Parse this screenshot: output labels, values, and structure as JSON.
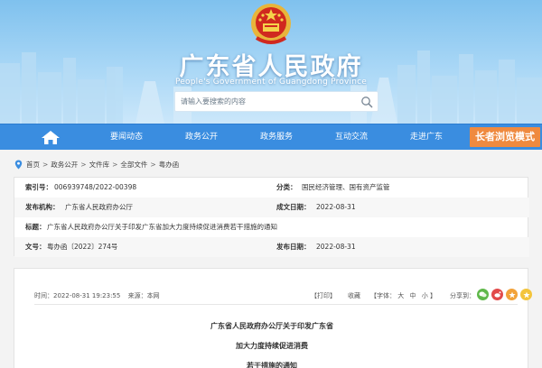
{
  "header": {
    "site_title": "广东省人民政府",
    "site_subtitle": "People's Government of Guangdong Province",
    "search_placeholder": "请输入要搜索的内容",
    "emblem_icon": "national-emblem-icon"
  },
  "nav": {
    "home_icon": "home-icon",
    "items": [
      {
        "label": "要闻动态"
      },
      {
        "label": "政务公开"
      },
      {
        "label": "政务服务"
      },
      {
        "label": "互动交流"
      },
      {
        "label": "走进广东"
      }
    ],
    "elder_mode_label": "长者浏览模式",
    "bg_color": "#3a8de0",
    "elder_color": "#ef8a3f"
  },
  "breadcrumb": {
    "items": [
      "首页",
      "政务公开",
      "文件库",
      "全部文件"
    ],
    "separator": ">",
    "current": "粤办函"
  },
  "info": {
    "index_label": "索引号：",
    "index_value": "006939748/2022-00398",
    "category_label": "分类：",
    "category_value": "国民经济管理、国有资产监管",
    "issuer_label": "发布机构：",
    "issuer_value": "广东省人民政府办公厅",
    "created_label": "成文日期：",
    "created_value": "2022-08-31",
    "title_label": "标题：",
    "title_value": "广东省人民政府办公厅关于印发广东省加大力度持续促进消费若干措施的通知",
    "docno_label": "文号：",
    "docno_value": "粤办函〔2022〕274号",
    "published_label": "发布日期：",
    "published_value": "2022-08-31"
  },
  "article": {
    "time_label": "时间：",
    "time_value": "2022-08-31 19:23:55",
    "source_label": "来源：",
    "source_value": "本网",
    "print_label": "【打印】",
    "favorite_label": "收藏",
    "font_label": "【字体：",
    "font_large": "大",
    "font_medium": "中",
    "font_small": "小",
    "font_close": "】",
    "share_label": "分享到：",
    "share_icons": [
      "wechat-icon",
      "weibo-icon",
      "qzone-icon",
      "favorite-star-icon"
    ],
    "share_colors": [
      "#5fb84a",
      "#e24a4a",
      "#f2a23a",
      "#f3c43b"
    ],
    "doc_title_lines": [
      "广东省人民政府办公厅关于印发广东省",
      "加大力度持续促进消费",
      "若干措施的通知"
    ]
  }
}
